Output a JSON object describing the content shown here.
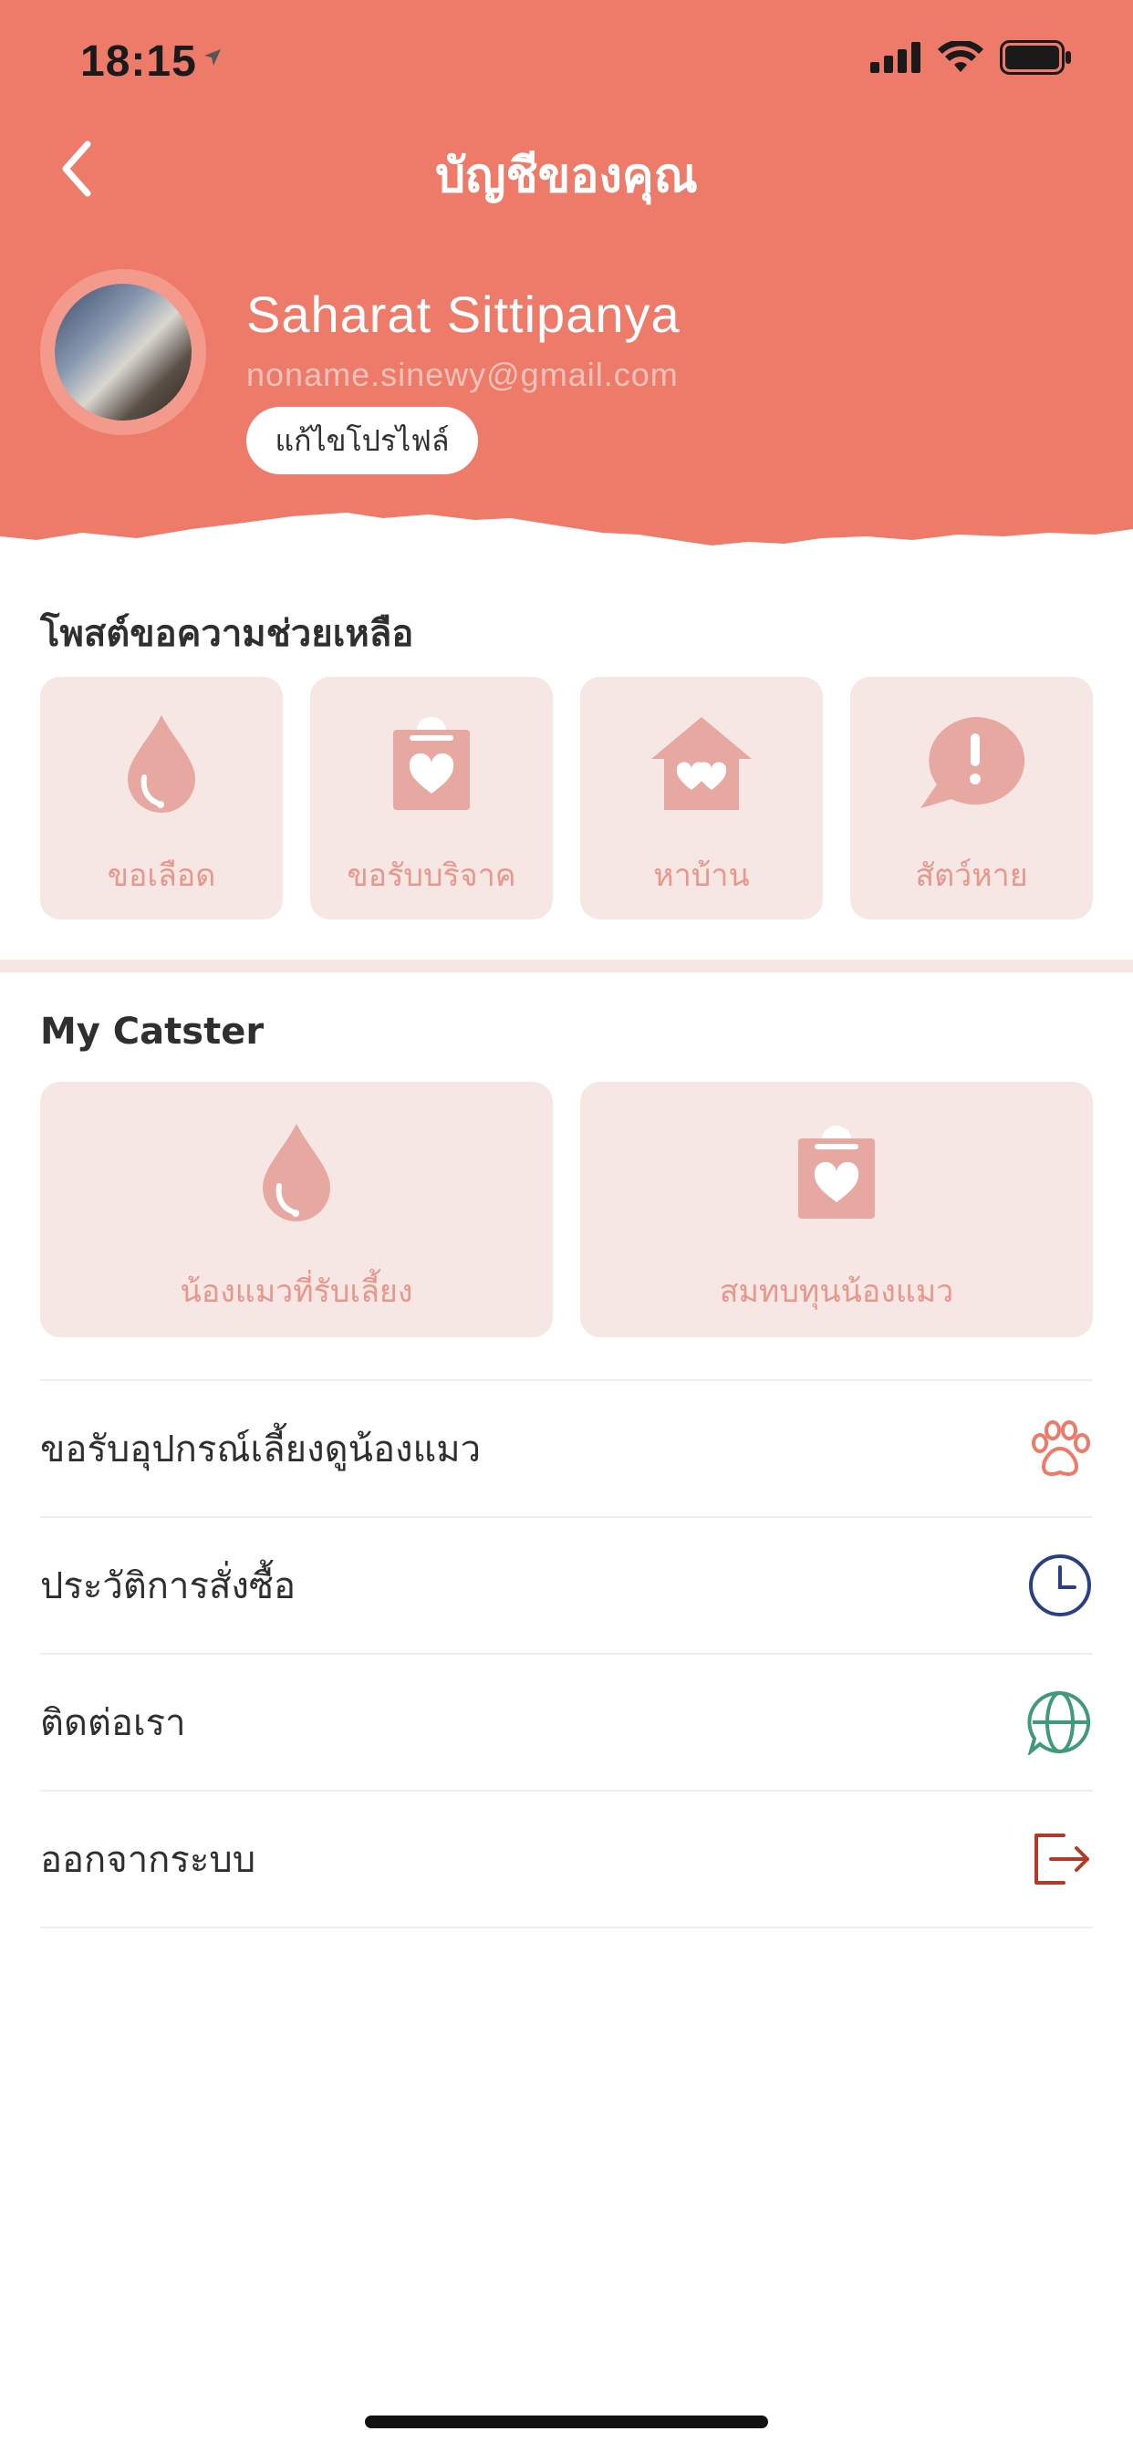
{
  "status_bar": {
    "time": "18:15"
  },
  "header": {
    "title": "บัญชีของคุณ",
    "background_color": "#ee7a69"
  },
  "profile": {
    "name": "Saharat Sittipanya",
    "email": "noname.sinewy@gmail.com",
    "edit_label": "แก้ไขโปรไฟล์"
  },
  "help_section": {
    "title": "โพสต์ขอความช่วยเหลือ",
    "items": [
      {
        "label": "ขอเลือด",
        "icon": "blood-drop-icon"
      },
      {
        "label": "ขอรับบริจาค",
        "icon": "donation-box-icon"
      },
      {
        "label": "หาบ้าน",
        "icon": "house-heart-icon"
      },
      {
        "label": "สัตว์หาย",
        "icon": "alert-bubble-icon"
      }
    ]
  },
  "catster_section": {
    "title": "My Catster",
    "items": [
      {
        "label": "น้องแมวที่รับเลี้ยง",
        "icon": "blood-drop-icon"
      },
      {
        "label": "สมทบทุนน้องแมว",
        "icon": "donation-box-icon"
      }
    ]
  },
  "menu": [
    {
      "label": "ขอรับอุปกรณ์เลี้ยงดูน้องแมว",
      "icon": "paw-icon",
      "color": "#ee7a69"
    },
    {
      "label": "ประวัติการสั่งซื้อ",
      "icon": "clock-icon",
      "color": "#2b3f86"
    },
    {
      "label": "ติดต่อเรา",
      "icon": "globe-chat-icon",
      "color": "#3f9a7c"
    },
    {
      "label": "ออกจากระบบ",
      "icon": "logout-icon",
      "color": "#b23a2a"
    }
  ]
}
